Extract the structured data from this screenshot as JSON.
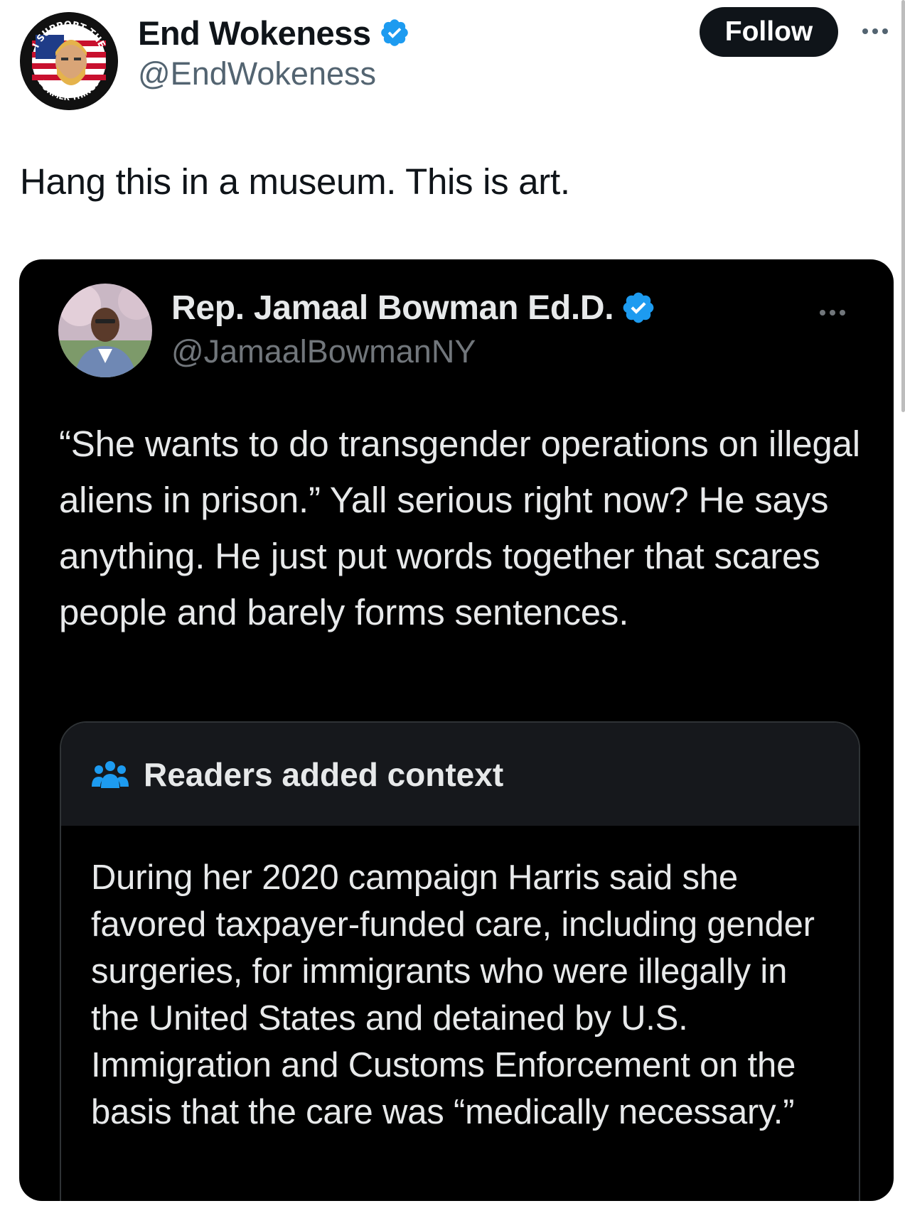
{
  "outer_tweet": {
    "author_name": "End Wokeness",
    "author_handle": "@EndWokeness",
    "follow_label": "Follow",
    "text": "Hang this in a museum. This is art.",
    "avatar": {
      "badge_top_text": "I SUPPORT THE",
      "badge_bottom_text": "FORMER THINGS",
      "icon": "flag-badge-avatar"
    }
  },
  "quoted_screenshot": {
    "author_name": "Rep. Jamaal Bowman Ed.D.",
    "author_handle": "@JamaalBowmanNY",
    "text": "“She wants to do transgender operations on illegal aliens in prison.” Yall serious right now? He says anything. He just put words together that scares people and barely forms sentences.",
    "community_note": {
      "title": "Readers added context",
      "body": "During her 2020 campaign Harris said she favored taxpayer-funded care, including gender surgeries, for immigrants who were illegally in the United States and detained by U.S. Immigration and Customs Enforcement on the basis that the care was “medically necessary.”"
    }
  },
  "colors": {
    "verified_blue": "#1d9bf0",
    "text_primary": "#0f1419",
    "text_secondary": "#536471",
    "dark_bg": "#000000",
    "dark_text": "#e7e9ea",
    "dark_secondary": "#71767b",
    "note_header_bg": "#16181c"
  }
}
